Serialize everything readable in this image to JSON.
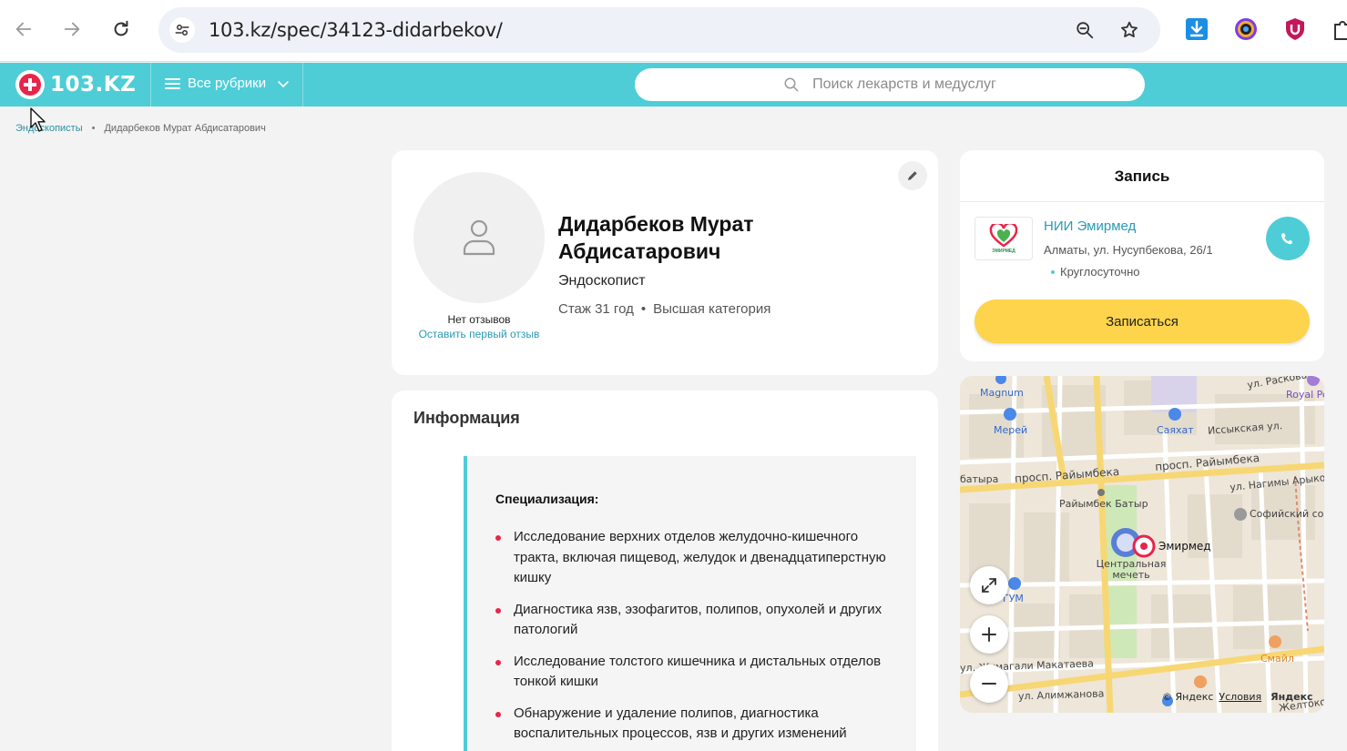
{
  "browser": {
    "url": "103.kz/spec/34123-didarbekov/"
  },
  "site": {
    "logo_text": "103.KZ",
    "rubrics_label": "Все рубрики",
    "search_placeholder": "Поиск лекарств и медуслуг"
  },
  "breadcrumbs": {
    "parent": "Эндоскописты",
    "separator": "•",
    "current": "Дидарбеков Мурат Абдисатарович"
  },
  "profile": {
    "name": "Дидарбеков Мурат Абдисатарович",
    "specialty": "Эндоскопист",
    "experience": "Стаж 31 год",
    "meta_separator": "•",
    "category": "Высшая категория",
    "reviews_none": "Нет отзывов",
    "leave_review": "Оставить первый отзыв"
  },
  "info": {
    "title": "Информация",
    "subtitle": "Специализация:",
    "items": [
      "Исследование верхних отделов желудочно-кишечного тракта, включая пищевод, желудок и двенадцатиперстную кишку",
      "Диагностика язв, эзофагитов, полипов, опухолей и других патологий",
      "Исследование толстого кишечника и дистальных отделов тонкой кишки",
      "Обнаружение и удаление полипов, диагностика воспалительных процессов, язв и других изменений"
    ]
  },
  "booking": {
    "title": "Запись",
    "clinic_name": "НИИ Эмирмед",
    "clinic_logo_text": "ЭМИРМЕД",
    "address": "Алматы, ул. Нусупбекова, 26/1",
    "hours": "Круглосуточно",
    "book_label": "Записаться"
  },
  "map": {
    "labels": {
      "magnum": "Magnum",
      "merey": "Мерей",
      "sayakhat": "Саяхат",
      "royal": "Royal Pe",
      "raskova": "ул. Раскова",
      "issyk": "Иссыкская ул.",
      "batyra": "батыра",
      "raiymbek1": "просп. Райымбека",
      "raiymbek2": "просп. Райымбека",
      "raiymbek_batyr": "Райымбек Батыр",
      "nagima": "ул. Нагимы Арыкова",
      "sofia": "Софийский соб",
      "emirmed": "Эмирмед",
      "mosque": "Центральная мечеть",
      "gum": "ГУМ",
      "smile": "Смайл",
      "makataeva": "ул. Жумагали Макатаева",
      "alimzhanova": "ул. Алимжанова",
      "zheltoksan": "Желтоксан"
    },
    "copyright": "© Яндекс",
    "terms": "Условия",
    "brand": "Яндекс"
  },
  "colors": {
    "accent": "#4ecdd7",
    "book_button": "#fdd44b",
    "bullet": "#e8244b",
    "link": "#2a9bb2"
  }
}
